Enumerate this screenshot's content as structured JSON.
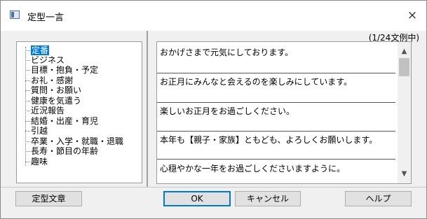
{
  "window": {
    "title": "定型一言"
  },
  "counter": "(1/24文例中)",
  "tree": {
    "items": [
      {
        "label": "定番",
        "selected": true
      },
      {
        "label": "ビジネス"
      },
      {
        "label": "目標・抱負・予定"
      },
      {
        "label": "お礼・感謝"
      },
      {
        "label": "質問・お願い"
      },
      {
        "label": "健康を気遣う"
      },
      {
        "label": "近況報告"
      },
      {
        "label": "結婚・出産・育児"
      },
      {
        "label": "引越"
      },
      {
        "label": "卒業・入学・就職・退職"
      },
      {
        "label": "長寿・節目の年齢"
      },
      {
        "label": "趣味"
      }
    ]
  },
  "phrases": [
    "おかげさまで元気にしております。",
    "お正月にみんなと会えるのを楽しみにしています。",
    "楽しいお正月をお過ごしください。",
    "本年も【親子・家族】ともども、よろしくお願いします。",
    "心穏やかな一年をお過ごしくださいますように。"
  ],
  "buttons": {
    "template": "定型文章",
    "ok": "OK",
    "cancel": "キャンセル",
    "help": "ヘルプ"
  },
  "icons": {
    "close": "close-icon",
    "app": "app-icon"
  }
}
